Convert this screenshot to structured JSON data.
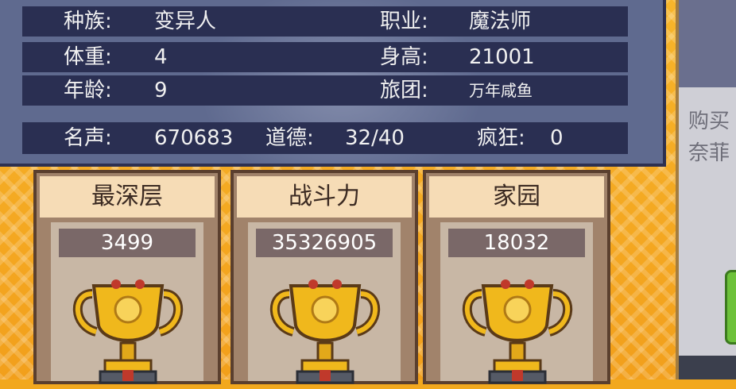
{
  "profile": {
    "race_label": "种族:",
    "race_value": "变异人",
    "class_label": "职业:",
    "class_value": "魔法师",
    "weight_label": "体重:",
    "weight_value": "4",
    "height_label": "身高:",
    "height_value": "21001",
    "age_label": "年龄:",
    "age_value": "9",
    "guild_label": "旅团:",
    "guild_value": "万年咸鱼",
    "fame_label": "名声:",
    "fame_value": "670683",
    "morality_label": "道德:",
    "morality_value": "32/40",
    "madness_label": "疯狂:",
    "madness_value": "0"
  },
  "trophies": [
    {
      "title": "最深层",
      "value": "3499"
    },
    {
      "title": "战斗力",
      "value": "35326905"
    },
    {
      "title": "家园",
      "value": "18032"
    }
  ],
  "side_panel": {
    "line1": "购买",
    "line2": "奈菲"
  },
  "colors": {
    "panel": "#5f6a8f",
    "row": "#2a2f52",
    "card_head": "#f6dcb6",
    "trophy_gold": "#f0b81c",
    "backdrop": "#f2a81e"
  }
}
